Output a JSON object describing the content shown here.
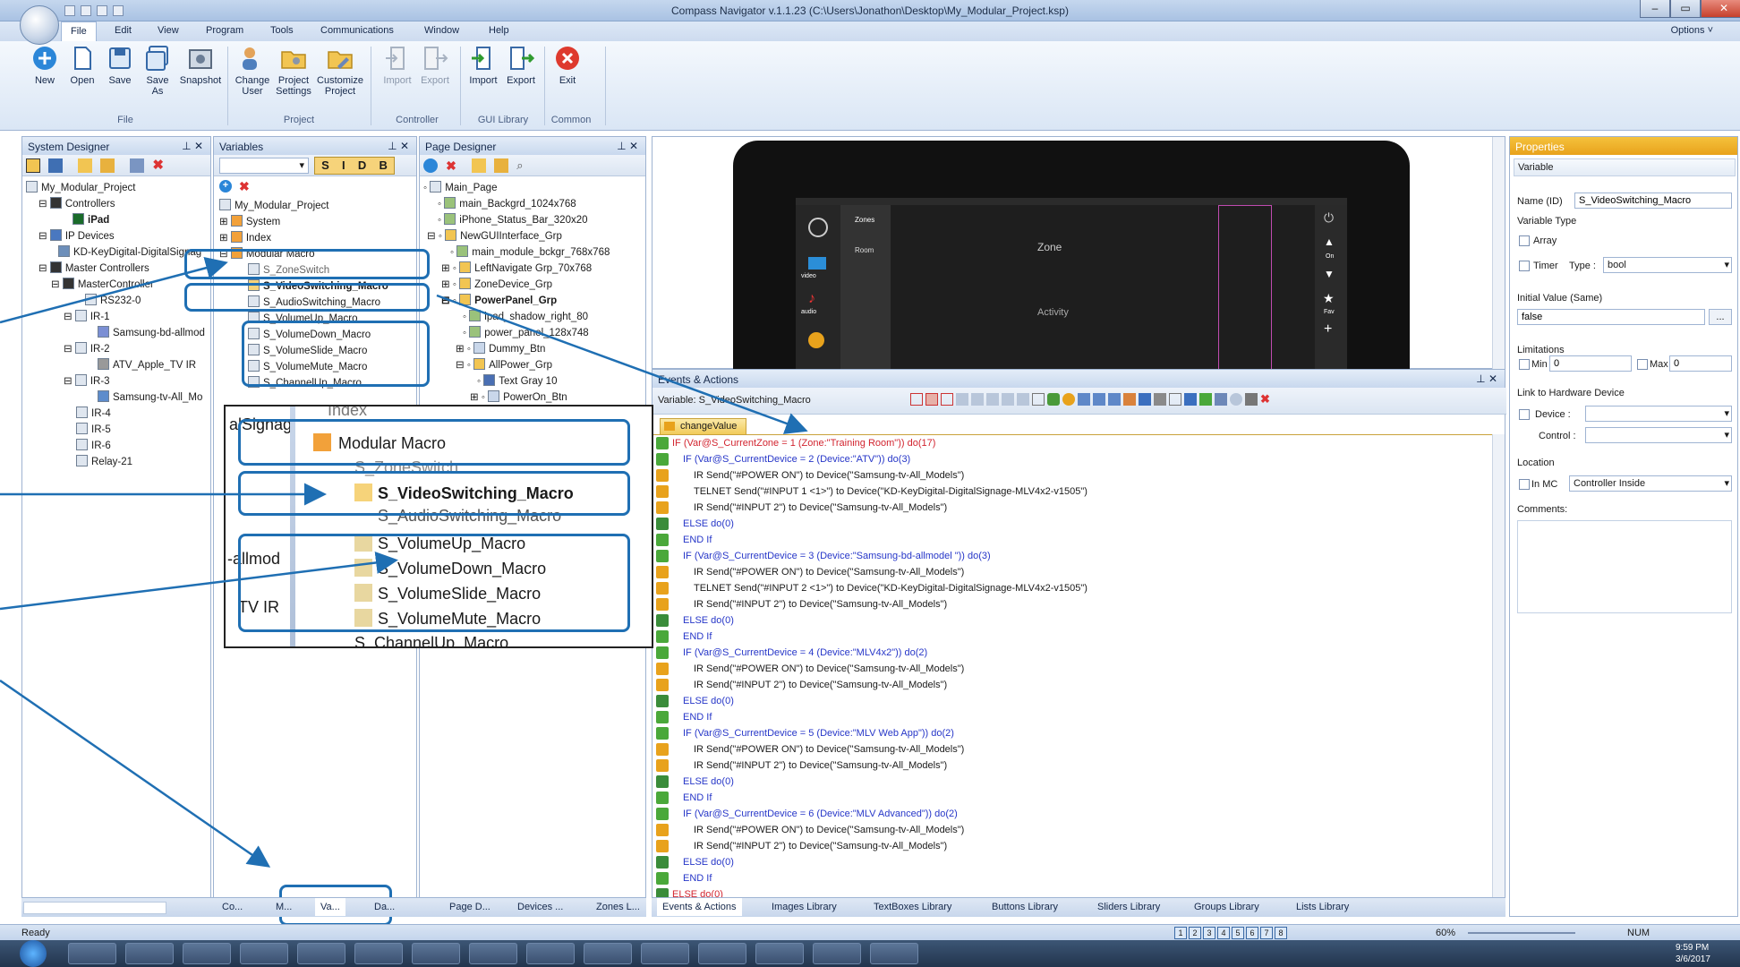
{
  "app": {
    "title": "Compass Navigator  v.1.1.23 (C:\\Users\\Jonathon\\Desktop\\My_Modular_Project.ksp)",
    "options_label": "Options ˅"
  },
  "menu": [
    "File",
    "Edit",
    "View",
    "Program",
    "Tools",
    "Communications",
    "Window",
    "Help"
  ],
  "ribbon": {
    "buttons": [
      {
        "label": "New"
      },
      {
        "label": "Open"
      },
      {
        "label": "Save"
      },
      {
        "label": "Save As"
      },
      {
        "label": "Snapshot"
      },
      {
        "label": "Change User"
      },
      {
        "label": "Project Settings"
      },
      {
        "label": "Customize Project"
      },
      {
        "label": "Import"
      },
      {
        "label": "Export"
      },
      {
        "label": "Import"
      },
      {
        "label": "Export"
      },
      {
        "label": "Exit"
      }
    ],
    "groups": [
      "File",
      "Project",
      "Controller",
      "GUI Library",
      "Common"
    ]
  },
  "system_designer": {
    "header": "System Designer",
    "items": [
      "My_Modular_Project",
      "Controllers",
      "iPad",
      "IP Devices",
      "KD-KeyDigital-DigitalSignag",
      "Master Controllers",
      "MasterController",
      "RS232-0",
      "IR-1",
      "Samsung-bd-allmod",
      "IR-2",
      "ATV_Apple_TV IR",
      "IR-3",
      "Samsung-tv-All_Mo",
      "IR-4",
      "IR-5",
      "IR-6",
      "Relay-21"
    ],
    "tabs": [
      "Co...",
      "M...",
      "Va...",
      "Da..."
    ]
  },
  "variables": {
    "header": "Variables",
    "filters": [
      "S",
      "I",
      "D",
      "B"
    ],
    "items": [
      "My_Modular_Project",
      "System",
      "Index",
      "Modular Macro",
      "S_ZoneSwitch",
      "S_VideoSwitching_Macro",
      "S_AudioSwitching_Macro",
      "S_VolumeUp_Macro",
      "S_VolumeDown_Macro",
      "S_VolumeSlide_Macro",
      "S_VolumeMute_Macro",
      "S_ChannelUp_Macro"
    ],
    "zoom_items": [
      "alSignag",
      "-allmod",
      "TV IR",
      "Index",
      "Modular Macro",
      "S_ZoneSwitch",
      "S_VideoSwitching_Macro",
      "S_AudioSwitching_Macro",
      "S_VolumeUp_Macro",
      "S_VolumeDown_Macro",
      "S_VolumeSlide_Macro",
      "S_VolumeMute_Macro",
      "S_ChannelUp_Macro"
    ]
  },
  "page_designer": {
    "header": "Page Designer",
    "items": [
      "Main_Page",
      "main_Backgrd_1024x768",
      "iPhone_Status_Bar_320x20",
      "NewGUIInterface_Grp",
      "main_module_bckgr_768x768",
      "LeftNavigate Grp_70x768",
      "ZoneDevice_Grp",
      "PowerPanel_Grp",
      "ipad_shadow_right_80",
      "power_panel_128x748",
      "Dummy_Btn",
      "AllPower_Grp",
      "Text Gray 10",
      "PowerOn_Btn"
    ],
    "tabs": [
      "Page D...",
      "Devices ...",
      "Zones L..."
    ]
  },
  "preview": {
    "nav": [
      "video",
      "audio",
      "Zones",
      "Room"
    ],
    "zone_label": "Zone",
    "activity_label": "Activity",
    "side": [
      "On",
      "Fav"
    ]
  },
  "events": {
    "header": "Events & Actions",
    "variable_label": "Variable: S_VideoSwitching_Macro",
    "tab": "changeValue",
    "lines": [
      {
        "t": "IF (Var@S_CurrentZone = 1 (Zone:\"Training Room\")) do(17)",
        "c": "red",
        "ind": 0,
        "g": "green"
      },
      {
        "t": "IF (Var@S_CurrentDevice = 2 (Device:\"ATV\")) do(3)",
        "c": "blue",
        "ind": 1,
        "g": "green"
      },
      {
        "t": "IR   Send(\"#POWER ON\") to Device(\"Samsung-tv-All_Models\")",
        "c": "dark",
        "ind": 2,
        "g": "ir"
      },
      {
        "t": "TELNET   Send(\"#INPUT 1 <1>\") to Device(\"KD-KeyDigital-DigitalSignage-MLV4x2-v1505\")",
        "c": "dark",
        "ind": 2,
        "g": "ir"
      },
      {
        "t": "IR   Send(\"#INPUT 2\") to Device(\"Samsung-tv-All_Models\")",
        "c": "dark",
        "ind": 2,
        "g": "ir"
      },
      {
        "t": "ELSE do(0)",
        "c": "blue",
        "ind": 1,
        "g": "else"
      },
      {
        "t": "END If",
        "c": "blue",
        "ind": 1,
        "g": "green"
      },
      {
        "t": "IF (Var@S_CurrentDevice = 3 (Device:\"Samsung-bd-allmodel \")) do(3)",
        "c": "blue",
        "ind": 1,
        "g": "green"
      },
      {
        "t": "IR   Send(\"#POWER ON\") to Device(\"Samsung-tv-All_Models\")",
        "c": "dark",
        "ind": 2,
        "g": "ir"
      },
      {
        "t": "TELNET   Send(\"#INPUT 2 <1>\") to Device(\"KD-KeyDigital-DigitalSignage-MLV4x2-v1505\")",
        "c": "dark",
        "ind": 2,
        "g": "ir"
      },
      {
        "t": "IR   Send(\"#INPUT 2\") to Device(\"Samsung-tv-All_Models\")",
        "c": "dark",
        "ind": 2,
        "g": "ir"
      },
      {
        "t": "ELSE do(0)",
        "c": "blue",
        "ind": 1,
        "g": "else"
      },
      {
        "t": "END If",
        "c": "blue",
        "ind": 1,
        "g": "green"
      },
      {
        "t": "IF (Var@S_CurrentDevice = 4 (Device:\"MLV4x2\")) do(2)",
        "c": "blue",
        "ind": 1,
        "g": "green"
      },
      {
        "t": "IR   Send(\"#POWER ON\") to Device(\"Samsung-tv-All_Models\")",
        "c": "dark",
        "ind": 2,
        "g": "ir"
      },
      {
        "t": "IR   Send(\"#INPUT 2\") to Device(\"Samsung-tv-All_Models\")",
        "c": "dark",
        "ind": 2,
        "g": "ir"
      },
      {
        "t": "ELSE do(0)",
        "c": "blue",
        "ind": 1,
        "g": "else"
      },
      {
        "t": "END If",
        "c": "blue",
        "ind": 1,
        "g": "green"
      },
      {
        "t": "IF (Var@S_CurrentDevice = 5 (Device:\"MLV Web App\")) do(2)",
        "c": "blue",
        "ind": 1,
        "g": "green"
      },
      {
        "t": "IR   Send(\"#POWER ON\") to Device(\"Samsung-tv-All_Models\")",
        "c": "dark",
        "ind": 2,
        "g": "ir"
      },
      {
        "t": "IR   Send(\"#INPUT 2\") to Device(\"Samsung-tv-All_Models\")",
        "c": "dark",
        "ind": 2,
        "g": "ir"
      },
      {
        "t": "ELSE do(0)",
        "c": "blue",
        "ind": 1,
        "g": "else"
      },
      {
        "t": "END If",
        "c": "blue",
        "ind": 1,
        "g": "green"
      },
      {
        "t": "IF (Var@S_CurrentDevice = 6 (Device:\"MLV Advanced\")) do(2)",
        "c": "blue",
        "ind": 1,
        "g": "green"
      },
      {
        "t": "IR   Send(\"#POWER ON\") to Device(\"Samsung-tv-All_Models\")",
        "c": "dark",
        "ind": 2,
        "g": "ir"
      },
      {
        "t": "IR   Send(\"#INPUT 2\") to Device(\"Samsung-tv-All_Models\")",
        "c": "dark",
        "ind": 2,
        "g": "ir"
      },
      {
        "t": "ELSE do(0)",
        "c": "blue",
        "ind": 1,
        "g": "else"
      },
      {
        "t": "END If",
        "c": "blue",
        "ind": 1,
        "g": "green"
      },
      {
        "t": "ELSE do(0)",
        "c": "red",
        "ind": 0,
        "g": "else"
      }
    ],
    "tabs": [
      "Events & Actions",
      "Images Library",
      "TextBoxes Library",
      "Buttons Library",
      "Sliders Library",
      "Groups Library",
      "Lists Library"
    ]
  },
  "properties": {
    "header": "Properties",
    "section": "Variable",
    "name_label": "Name (ID)",
    "name_value": "S_VideoSwitching_Macro",
    "type_section": "Variable Type",
    "array_label": "Array",
    "timer_label": "Timer",
    "type_label": "Type :",
    "type_value": "bool",
    "initial_label": "Initial Value (Same)",
    "initial_value": "false",
    "initial_btn": "...",
    "limitations_label": "Limitations",
    "min_label": "Min",
    "min_value": "0",
    "max_label": "Max",
    "max_value": "0",
    "link_label": "Link to Hardware Device",
    "device_label": "Device :",
    "control_label": "Control :",
    "location_label": "Location",
    "inmc_label": "In MC",
    "location_value": "Controller Inside",
    "comments_label": "Comments:"
  },
  "status": {
    "ready": "Ready",
    "zoom": "60%",
    "num": "NUM",
    "pages": [
      "1",
      "2",
      "3",
      "4",
      "5",
      "6",
      "7",
      "8"
    ]
  },
  "taskbar": {
    "time": "9:59 PM",
    "date": "3/6/2017"
  },
  "colors": {
    "callout": "#1f6fb3",
    "if_red": "#d2242f",
    "if_blue": "#2636c8"
  }
}
